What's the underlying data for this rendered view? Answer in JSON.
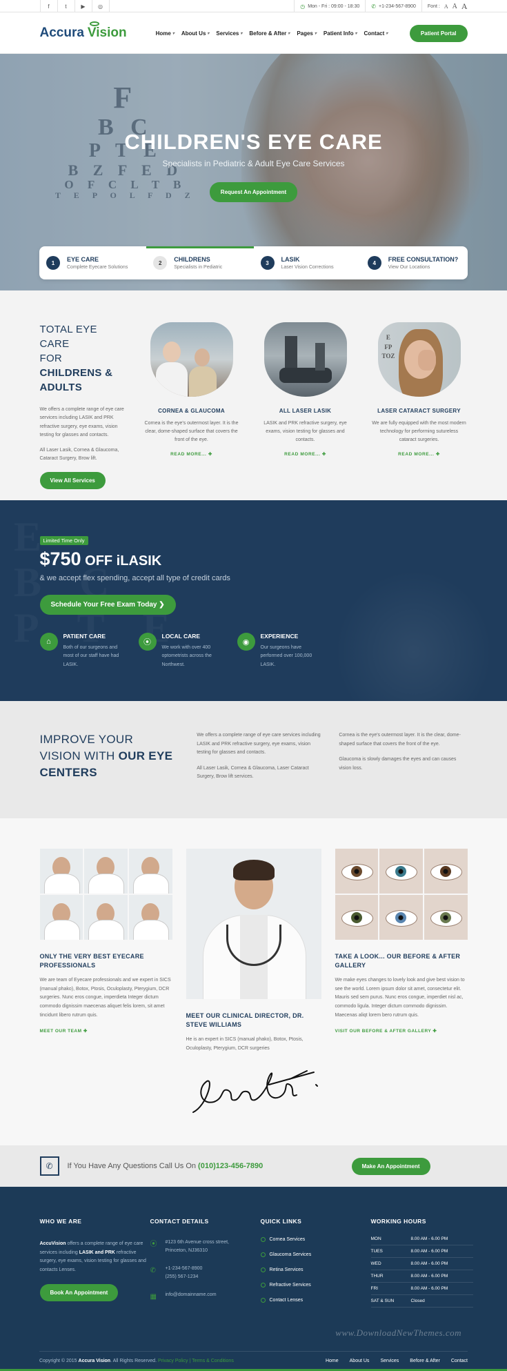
{
  "topbar": {
    "social": [
      "f",
      "t",
      "▶",
      "◎"
    ],
    "hours": "Mon - Fri : 09:00 - 18:30",
    "phone": "+1-234-567-8900",
    "font_label": "Font :",
    "font_sizes": [
      "A",
      "A",
      "A"
    ]
  },
  "header": {
    "logo_a": "Accura",
    "logo_b": "Vision",
    "nav": [
      "Home",
      "About Us",
      "Services",
      "Before & After",
      "Pages",
      "Patient Info",
      "Contact"
    ],
    "portal": "Patient Portal"
  },
  "hero": {
    "eye_chart": [
      "F",
      "B  C",
      "P  T  E",
      "B  Z  F  E  D",
      "O  F  C  L  T  B",
      "T  E  P  O  L  F  D  Z"
    ],
    "title": "CHILDREN'S EYE CARE",
    "subtitle": "Specialists in Pediatric & Adult Eye Care Services",
    "cta": "Request An Appointment",
    "features": [
      {
        "num": "1",
        "title": "EYE CARE",
        "sub": "Complete Eyecare Solutions"
      },
      {
        "num": "2",
        "title": "CHILDRENS",
        "sub": "Specialists in Pediatric"
      },
      {
        "num": "3",
        "title": "LASIK",
        "sub": "Laser Vision Corrections"
      },
      {
        "num": "4",
        "title": "FREE CONSULTATION?",
        "sub": "View Our Locations"
      }
    ]
  },
  "care": {
    "title_1": "TOTAL EYE CARE",
    "title_2": "FOR ",
    "title_bold": "CHILDRENS & ADULTS",
    "para_1": "We offers a complete range of eye care services including LASIK and PRK refractive surgery, eye exams, vision testing for glasses and contacts.",
    "para_2": "All Laser Lasik, Cornea & Glaucoma, Cataract Surgery, Brow lift.",
    "button": "View All Services",
    "services": [
      {
        "title": "CORNEA & GLAUCOMA",
        "text": "Cornea is the eye's outermost layer. It is the clear, dome-shaped surface that covers the front of the eye.",
        "more": "READ MORE...  ✚"
      },
      {
        "title": "ALL LASER LASIK",
        "text": "LASIK and PRK refractive surgery, eye exams, vision testing for glasses and contacts.",
        "more": "READ MORE...  ✚"
      },
      {
        "title": "LASER CATARACT SURGERY",
        "text": "We are fully equipped with the most modern technology for performing sutureless cataract surgeries.",
        "more": "READ MORE...  ✚"
      }
    ]
  },
  "offer": {
    "badge": "Limited Time Only",
    "price": "$750",
    "price_rest": " OFF iLASIK",
    "sub": "& we accept flex spending, accept all type of credit cards",
    "button": "Schedule Your Free Exam Today  ❯",
    "perks": [
      {
        "icon": "⌂",
        "title": "PATIENT CARE",
        "text": "Both of our surgeons and most of our staff have had LASIK."
      },
      {
        "icon": "⦿",
        "title": "LOCAL CARE",
        "text": "We work with over 400 optometrists across the Northwest."
      },
      {
        "icon": "◉",
        "title": "EXPERIENCE",
        "text": "Our surgeons have performed over 100,000 LASIK."
      }
    ]
  },
  "improve": {
    "title_1": "IMPROVE YOUR",
    "title_2": "VISION WITH ",
    "title_bold": "OUR EYE CENTERS",
    "col1_p1": "We offers a complete range of eye care services including LASIK and PRK refractive surgery, eye exams, vision testing for glasses and contacts.",
    "col1_p2": "All Laser Lasik, Cornea & Glaucoma, Laser Cataract Surgery, Brow lift services.",
    "col2_p1": "Cornea is the eye's outermost layer. It is the clear, dome-shaped surface that covers the front of the eye.",
    "col2_p2": "Glaucoma is slowly damages the eyes and can causes vision loss."
  },
  "team": {
    "col1_title": "ONLY THE VERY BEST EYECARE PROFESSIONALS",
    "col1_text": "We are team of Eyecare professionals and we expert in SICS (manual phako), Botox, Ptosis, Oculoplasty, Pterygium, DCR surgeries. Nunc eros congue, imperdieta Integer dictum commodo dignissim maecenas aliquet felis lorem, sit amet tincidunt libero rutrum quis.",
    "col1_link": "MEET OUR TEAM  ✚",
    "col2_title": "MEET OUR CLINICAL DIRECTOR, DR. STEVE WILLIAMS",
    "col2_text": "He is an expert in SICS (manual phako), Botox, Ptosis, Oculoplasty, Pterygium, DCR surgeries",
    "col3_title": "TAKE A LOOK... OUR BEFORE & AFTER GALLERY",
    "col3_text": "We make eyes changes to lovely look and give best vision to see the world. Lorem ipsum dolor sit amet, consectetur elit. Mauris sed sem purus. Nunc eros congue, imperdiet nisl ac, commodo ligula. Integer dictum commodo dignissim. Maecenas aliqt lorem bero rutrum quis.",
    "col3_link": "VISIT OUR BEFORE & AFTER GALLERY  ✚",
    "iris_colors": [
      "#6b4a2e",
      "#3a7a8c",
      "#5a3a22",
      "#4a5a30",
      "#5a86b0",
      "#6a7a50",
      "#4a7a5a",
      "#4f74a6",
      "#7a6a40"
    ]
  },
  "callout": {
    "text": "If You Have Any Questions Call Us On ",
    "phone": "(010)123-456-7890",
    "button": "Make An Appointment"
  },
  "footer": {
    "who_title": "WHO WE ARE",
    "who_brand": "AccuVision",
    "who_text_1": " offers a complete range of eye care services including ",
    "who_bold_1": "LASIK and PRK",
    "who_text_2": " refractive surgery, eye exams, vision testing for glasses and contacts Lenses.",
    "who_button": "Book An Appointment",
    "contact_title": "CONTACT DETAILS",
    "address_1": "#123 6th Avenue cross street,",
    "address_2": "Princeton, NJ36310",
    "phone_1": "+1-234-567-8900",
    "phone_2": "(255) 567-1234",
    "email": "info@domainname.com",
    "links_title": "QUICK LINKS",
    "links": [
      "Cornea Services",
      "Glaucoma Services",
      "Retina Services",
      "Refractive Services",
      "Contact Lenses"
    ],
    "hours_title": "WORKING HOURS",
    "hours": [
      {
        "day": "MON",
        "time": "8.00 AM - 6.00 PM"
      },
      {
        "day": "TUES",
        "time": "8.00 AM - 6.00 PM"
      },
      {
        "day": "WED",
        "time": "8.00 AM - 6.00 PM"
      },
      {
        "day": "THUR",
        "time": "8.00 AM - 6.00 PM"
      },
      {
        "day": "FRI",
        "time": "8.00 AM - 6.00 PM"
      },
      {
        "day": "SAT & SUN",
        "time": "Closed"
      }
    ],
    "watermark": "www.DownloadNewThemes.com",
    "copyright_1": "Copyright © 2015 ",
    "copyright_brand": "Accura Vision",
    "copyright_2": ". All Rights Reserved. ",
    "privacy": "Privacy Policy",
    "sep": " | ",
    "terms": "Terms & Conditions",
    "bottom_nav": [
      "Home",
      "About Us",
      "Services",
      "Before & After",
      "Contact"
    ]
  },
  "colors": {
    "accent": "#3d9b3d",
    "navy": "#1f3c5c"
  }
}
